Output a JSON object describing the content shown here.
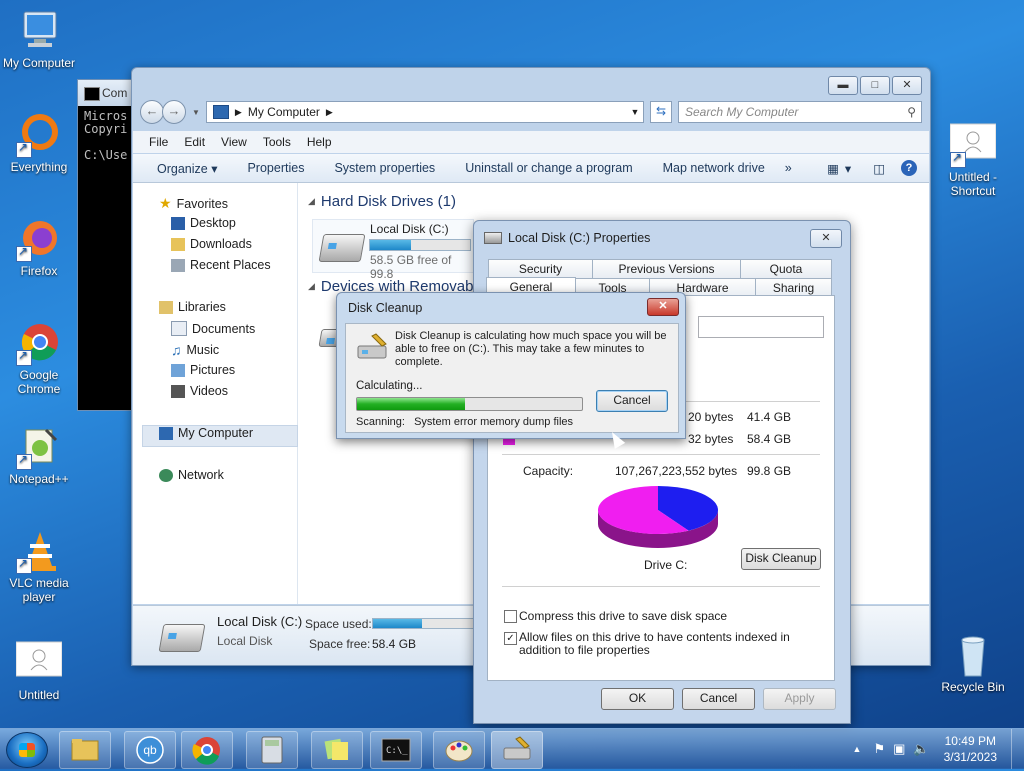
{
  "desktop": {
    "icons": {
      "my_computer": "My Computer",
      "everything": "Everything",
      "firefox": "Firefox",
      "chrome": "Google Chrome",
      "notepadpp": "Notepad++",
      "vlc": "VLC media player",
      "untitled": "Untitled",
      "untitled_shortcut": "Untitled - Shortcut",
      "recycle_bin": "Recycle Bin"
    }
  },
  "cmd": {
    "title": "Com",
    "line1": "Micros",
    "line2": "Copyri",
    "line3": "C:\\Use"
  },
  "explorer": {
    "address": "My Computer",
    "search_placeholder": "Search My Computer",
    "menu": [
      "File",
      "Edit",
      "View",
      "Tools",
      "Help"
    ],
    "toolbar": {
      "organize": "Organize ▾",
      "properties": "Properties",
      "system_properties": "System properties",
      "uninstall": "Uninstall or change a program",
      "map_drive": "Map network drive",
      "more": "»"
    },
    "nav": {
      "favorites": "Favorites",
      "desktop": "Desktop",
      "downloads": "Downloads",
      "recent": "Recent Places",
      "libraries": "Libraries",
      "documents": "Documents",
      "music": "Music",
      "pictures": "Pictures",
      "videos": "Videos",
      "my_computer": "My Computer",
      "network": "Network"
    },
    "groups": {
      "hdd": "Hard Disk Drives (1)",
      "removable": "Devices with Removable"
    },
    "drive": {
      "name": "Local Disk (C:)",
      "free": "58.5 GB free of 99.8",
      "used_fraction": 0.41
    },
    "details": {
      "name": "Local Disk (C:)",
      "type": "Local Disk",
      "space_used_label": "Space used:",
      "space_free_label": "Space free:",
      "space_free": "58.4 GB"
    }
  },
  "properties": {
    "title": "Local Disk (C:) Properties",
    "close": "✕",
    "tabs_row1": [
      "Security",
      "Previous Versions",
      "Quota"
    ],
    "tabs_row2": [
      "General",
      "Tools",
      "Hardware",
      "Sharing"
    ],
    "used_bytes": "20 bytes",
    "used_gb": "41.4 GB",
    "free_bytes": "32 bytes",
    "free_gb": "58.4 GB",
    "capacity_label": "Capacity:",
    "capacity_bytes": "107,267,223,552 bytes",
    "capacity_gb": "99.8 GB",
    "drive_label": "Drive C:",
    "disk_cleanup_button": "Disk Cleanup",
    "compress_label": "Compress this drive to save disk space",
    "index_label": "Allow files on this drive to have contents indexed in addition to file properties",
    "ok": "OK",
    "cancel": "Cancel",
    "apply": "Apply",
    "pie": {
      "used_fraction": 0.415,
      "colors": {
        "used": "#1e1ef0",
        "free": "#f01ef0"
      }
    }
  },
  "cleanup": {
    "title": "Disk Cleanup",
    "close": "✕",
    "message": "Disk Cleanup is calculating how much space you will be able to free on  (C:). This may take a few minutes to complete.",
    "status": "Calculating...",
    "cancel": "Cancel",
    "scanning": "Scanning:   System error memory dump files",
    "progress_fraction": 0.48
  },
  "taskbar": {
    "time": "10:49 PM",
    "date": "3/31/2023"
  }
}
